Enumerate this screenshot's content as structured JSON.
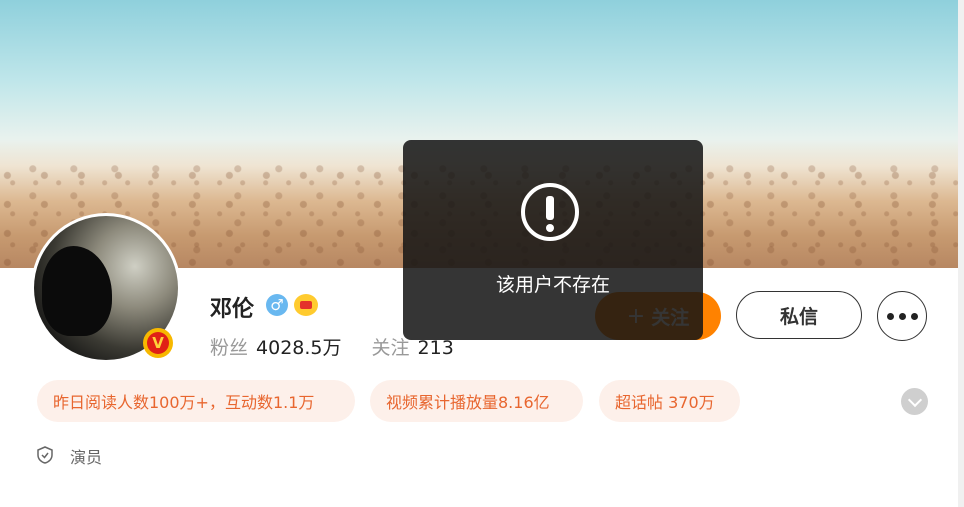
{
  "profile": {
    "name": "邓伦",
    "gender_icon": "male-icon",
    "vip_icon": "crown-icon",
    "verify_badge": "V",
    "followers_label": "粉丝",
    "followers_value": "4028.5万",
    "following_label": "关注",
    "following_value": "213",
    "occupation": "演员"
  },
  "actions": {
    "follow_plus": "+",
    "follow_label": "关注",
    "message_label": "私信"
  },
  "tags": [
    {
      "label": "昨日阅读人数100万+，互动数1.1万"
    },
    {
      "label": "视频累计播放量8.16亿"
    },
    {
      "label": "超话帖 370万"
    }
  ],
  "toast": {
    "icon": "exclamation-circle-icon",
    "message": "该用户不存在"
  },
  "colors": {
    "follow_button": "#ff8200",
    "tag_text": "#e8662f",
    "tag_bg": "#fdf0ea",
    "toast_bg": "#141414"
  }
}
